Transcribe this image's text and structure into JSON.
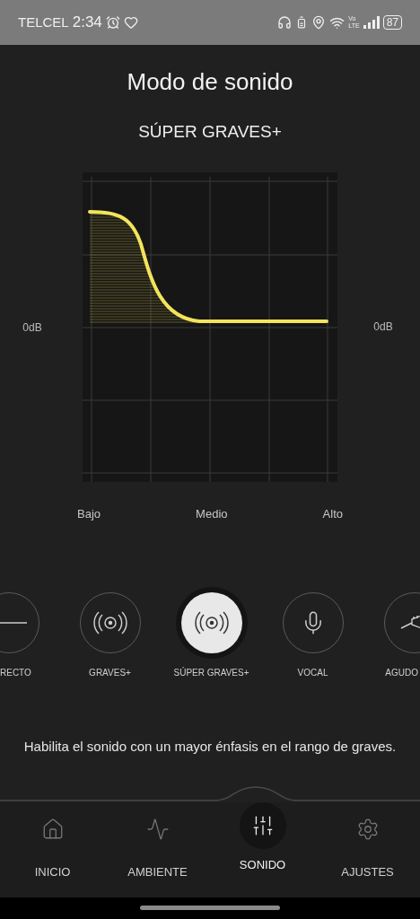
{
  "status_bar": {
    "carrier": "TELCEL",
    "time": "2:34",
    "volte_top": "Vo",
    "volte_bottom": "LTE",
    "battery": "87"
  },
  "title": "Modo de sonido",
  "mode_name": "SÚPER GRAVES+",
  "eq": {
    "gain_left": "0dB",
    "gain_right": "0dB",
    "bands": [
      "Bajo",
      "Medio",
      "Alto"
    ]
  },
  "modes": [
    {
      "kind": "flat",
      "label": "RECTO",
      "selected": false
    },
    {
      "kind": "bass",
      "label": "GRAVES+",
      "selected": false
    },
    {
      "kind": "bass",
      "label": "SÚPER GRAVES+",
      "selected": true
    },
    {
      "kind": "vocal",
      "label": "VOCAL",
      "selected": false
    },
    {
      "kind": "treble",
      "label": "AGUDO",
      "selected": false
    }
  ],
  "description": "Habilita el sonido con un mayor énfasis en el rango de graves.",
  "nav": [
    {
      "kind": "home",
      "label": "INICIO",
      "selected": false
    },
    {
      "kind": "ambient",
      "label": "AMBIENTE",
      "selected": false
    },
    {
      "kind": "sound",
      "label": "SONIDO",
      "selected": true
    },
    {
      "kind": "settings",
      "label": "AJUSTES",
      "selected": false
    }
  ]
}
